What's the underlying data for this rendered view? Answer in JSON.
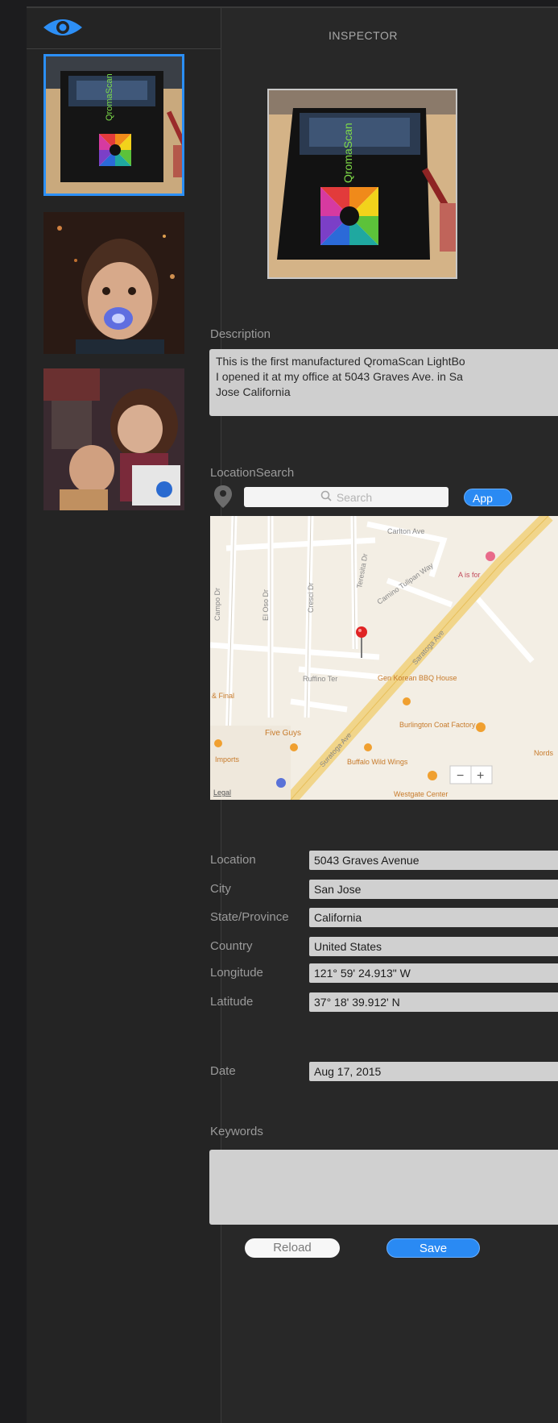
{
  "sidebar": {
    "header_icon": "eye-icon",
    "thumbnails": [
      {
        "name": "thumb-lightbox",
        "selected": true,
        "brand_text": "QromaScan"
      },
      {
        "name": "thumb-child-pacifier",
        "selected": false
      },
      {
        "name": "thumb-kids-selfie",
        "selected": false
      }
    ]
  },
  "inspector": {
    "title": "INSPECTOR",
    "preview_brand_text": "QromaScan"
  },
  "description": {
    "label": "Description",
    "text": "This is the first manufactured QromaScan LightBo\nI opened it at my office at 5043 Graves Ave. in Sa\nJose California"
  },
  "location_search": {
    "label": "LocationSearch",
    "pin_icon": "map-pin-icon",
    "search_placeholder": "Search",
    "apply_label": "App"
  },
  "map": {
    "streets": [
      "Carlton Ave",
      "Campo Dr",
      "El Oso Dr",
      "Cresci Dr",
      "Teresita Dr",
      "Camino Tulipan Way",
      "Saratoga Ave",
      "Ruffino Ter",
      "Suratoga Ave"
    ],
    "pois": [
      "A is for",
      "Gen Korean BBQ House",
      "Burlington Coat Factory",
      "Five Guys",
      "Buffalo Wild Wings",
      "Nords",
      "Westgate Center",
      "& Final",
      "Imports"
    ],
    "legal": "Legal",
    "zoom_out": "−",
    "zoom_in": "+"
  },
  "fields": [
    {
      "label": "Location",
      "value": "5043 Graves Avenue"
    },
    {
      "label": "City",
      "value": "San Jose"
    },
    {
      "label": "State/Province",
      "value": "California"
    },
    {
      "label": "Country",
      "value": "United States"
    },
    {
      "label": "Longitude",
      "value": "121° 59' 24.913\" W"
    },
    {
      "label": "Latitude",
      "value": "37° 18' 39.912' N"
    }
  ],
  "date": {
    "label": "Date",
    "value": "Aug 17, 2015"
  },
  "keywords": {
    "label": "Keywords",
    "value": ""
  },
  "buttons": {
    "reload": "Reload",
    "save": "Save"
  },
  "colors": {
    "accent": "#2a8af3",
    "window_bg": "#282828",
    "field_bg": "#d0d0d0"
  }
}
